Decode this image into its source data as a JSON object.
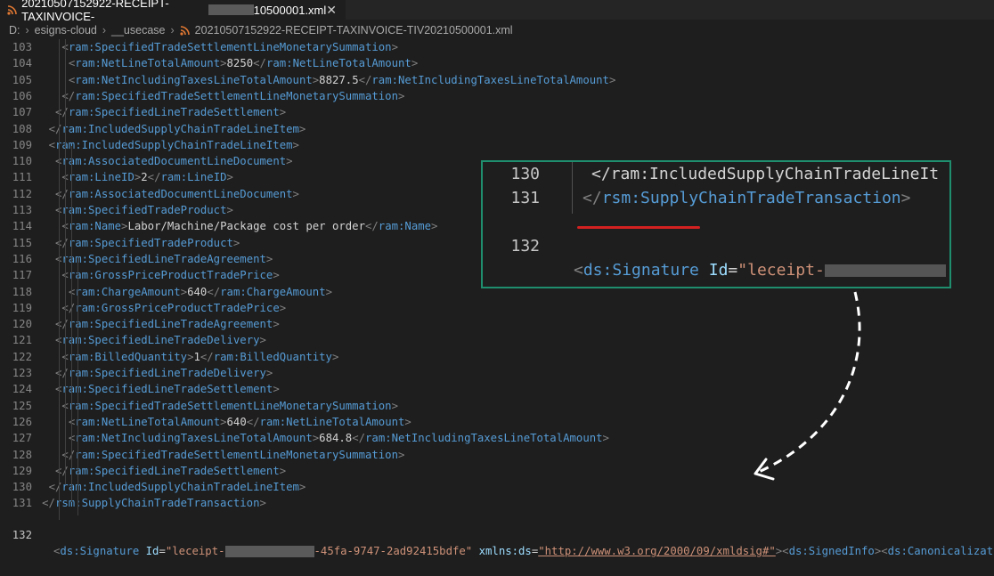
{
  "tab": {
    "title_prefix": "20210507152922-RECEIPT-TAXINVOICE-",
    "title_suffix": "10500001.xml",
    "close": "✕",
    "icon": "rss-icon"
  },
  "breadcrumb": {
    "drive": "D:",
    "folder1": "esigns-cloud",
    "folder2": "__usecase",
    "file": "20210507152922-RECEIPT-TAXINVOICE-TIV20210500001.xml"
  },
  "lines": [
    {
      "n": "103",
      "c": "<ram:SpecifiedTradeSettlementLineMonetarySummation>"
    },
    {
      "n": "104",
      "c": "<ram:NetLineTotalAmount>8250</ram:NetLineTotalAmount>"
    },
    {
      "n": "105",
      "c": "<ram:NetIncludingTaxesLineTotalAmount>8827.5</ram:NetIncludingTaxesLineTotalAmount>"
    },
    {
      "n": "106",
      "c": "</ram:SpecifiedTradeSettlementLineMonetarySummation>"
    },
    {
      "n": "107",
      "c": "</ram:SpecifiedLineTradeSettlement>"
    },
    {
      "n": "108",
      "c": "</ram:IncludedSupplyChainTradeLineItem>"
    },
    {
      "n": "109",
      "c": "<ram:IncludedSupplyChainTradeLineItem>"
    },
    {
      "n": "110",
      "c": "<ram:AssociatedDocumentLineDocument>"
    },
    {
      "n": "111",
      "c": "<ram:LineID>2</ram:LineID>"
    },
    {
      "n": "112",
      "c": "</ram:AssociatedDocumentLineDocument>"
    },
    {
      "n": "113",
      "c": "<ram:SpecifiedTradeProduct>"
    },
    {
      "n": "114",
      "c": "<ram:Name>Labor/Machine/Package cost per order</ram:Name>"
    },
    {
      "n": "115",
      "c": "</ram:SpecifiedTradeProduct>"
    },
    {
      "n": "116",
      "c": "<ram:SpecifiedLineTradeAgreement>"
    },
    {
      "n": "117",
      "c": "<ram:GrossPriceProductTradePrice>"
    },
    {
      "n": "118",
      "c": "<ram:ChargeAmount>640</ram:ChargeAmount>"
    },
    {
      "n": "119",
      "c": "</ram:GrossPriceProductTradePrice>"
    },
    {
      "n": "120",
      "c": "</ram:SpecifiedLineTradeAgreement>"
    },
    {
      "n": "121",
      "c": "<ram:SpecifiedLineTradeDelivery>"
    },
    {
      "n": "122",
      "c": "<ram:BilledQuantity>1</ram:BilledQuantity>"
    },
    {
      "n": "123",
      "c": "</ram:SpecifiedLineTradeDelivery>"
    },
    {
      "n": "124",
      "c": "<ram:SpecifiedLineTradeSettlement>"
    },
    {
      "n": "125",
      "c": "<ram:SpecifiedTradeSettlementLineMonetarySummation>"
    },
    {
      "n": "126",
      "c": "<ram:NetLineTotalAmount>640</ram:NetLineTotalAmount>"
    },
    {
      "n": "127",
      "c": "<ram:NetIncludingTaxesLineTotalAmount>684.8</ram:NetIncludingTaxesLineTotalAmount>"
    },
    {
      "n": "128",
      "c": "</ram:SpecifiedTradeSettlementLineMonetarySummation>"
    },
    {
      "n": "129",
      "c": "</ram:SpecifiedLineTradeSettlement>"
    },
    {
      "n": "130",
      "c": "</ram:IncludedSupplyChainTradeLineItem>"
    },
    {
      "n": "131",
      "c": "</rsm:SupplyChainTradeTransaction>"
    }
  ],
  "line132": {
    "n": "132",
    "tag": "ds:Signature",
    "attr_id": "Id",
    "id_prefix": "\"leceipt-",
    "id_suffix": "-45fa-9747-2ad92415bdfe\"",
    "attr_xmlns": "xmlns:ds",
    "xmlns_value": "\"http://www.w3.org/2000/09/xmldsig#\"",
    "tail1": "ds:SignedInfo",
    "tail2": "ds:Canonicalization"
  },
  "zoom": {
    "lines": [
      {
        "n": "130",
        "c": "</ram:IncludedSupplyChainTradeLineIt"
      },
      {
        "n": "131",
        "c": "</rsm:SupplyChainTradeTransaction>"
      }
    ],
    "n132": "132",
    "tag": "ds:Signature",
    "attr": "Id",
    "val_prefix": "\"leceipt-"
  },
  "colors": {
    "tag": "#569cd6",
    "bracket": "#808080",
    "attr_name": "#9cdcfe",
    "attr_value": "#ce9178",
    "text": "#d4d4d4",
    "highlight_border": "#1e8e6e",
    "underline": "#d32020"
  }
}
